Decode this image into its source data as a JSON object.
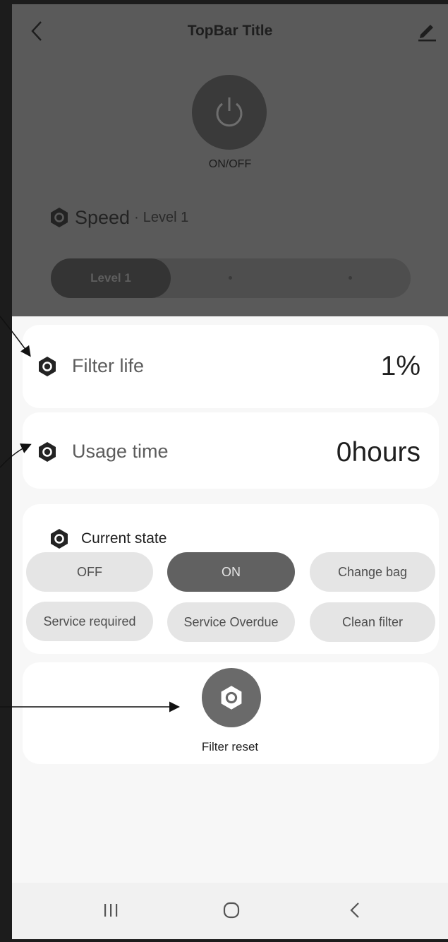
{
  "colors": {
    "overlay_dark": "#5a5a5a",
    "card_bg": "#ffffff",
    "screen_bg": "#f7f7f7",
    "chip_bg": "#e5e5e5",
    "chip_active": "#616161",
    "icon_dark": "#232323"
  },
  "topbar": {
    "title": "TopBar Title",
    "back_icon": "chevron-left-icon",
    "edit_icon": "pencil-icon"
  },
  "power": {
    "label": "ON/OFF",
    "icon": "power-icon"
  },
  "speed": {
    "label": "Speed",
    "separator": "·",
    "value": "Level 1",
    "icon": "hex-nut-icon",
    "levels": [
      "Level 1",
      "",
      ""
    ],
    "selected_index": 0
  },
  "filter_life": {
    "label": "Filter life",
    "value": "1%",
    "icon": "hex-nut-icon"
  },
  "usage_time": {
    "label": "Usage time",
    "value": "0hours",
    "icon": "hex-nut-icon"
  },
  "current_state": {
    "title": "Current state",
    "icon": "hex-nut-icon",
    "options": [
      "OFF",
      "ON",
      "Change bag",
      "Service required",
      "Service Overdue",
      "Clean filter"
    ],
    "selected": "ON"
  },
  "filter_reset": {
    "label": "Filter reset",
    "icon": "hex-nut-icon"
  },
  "navbar": {
    "recents_icon": "recents-icon",
    "home_icon": "home-icon",
    "back_icon": "back-chevron-icon"
  }
}
